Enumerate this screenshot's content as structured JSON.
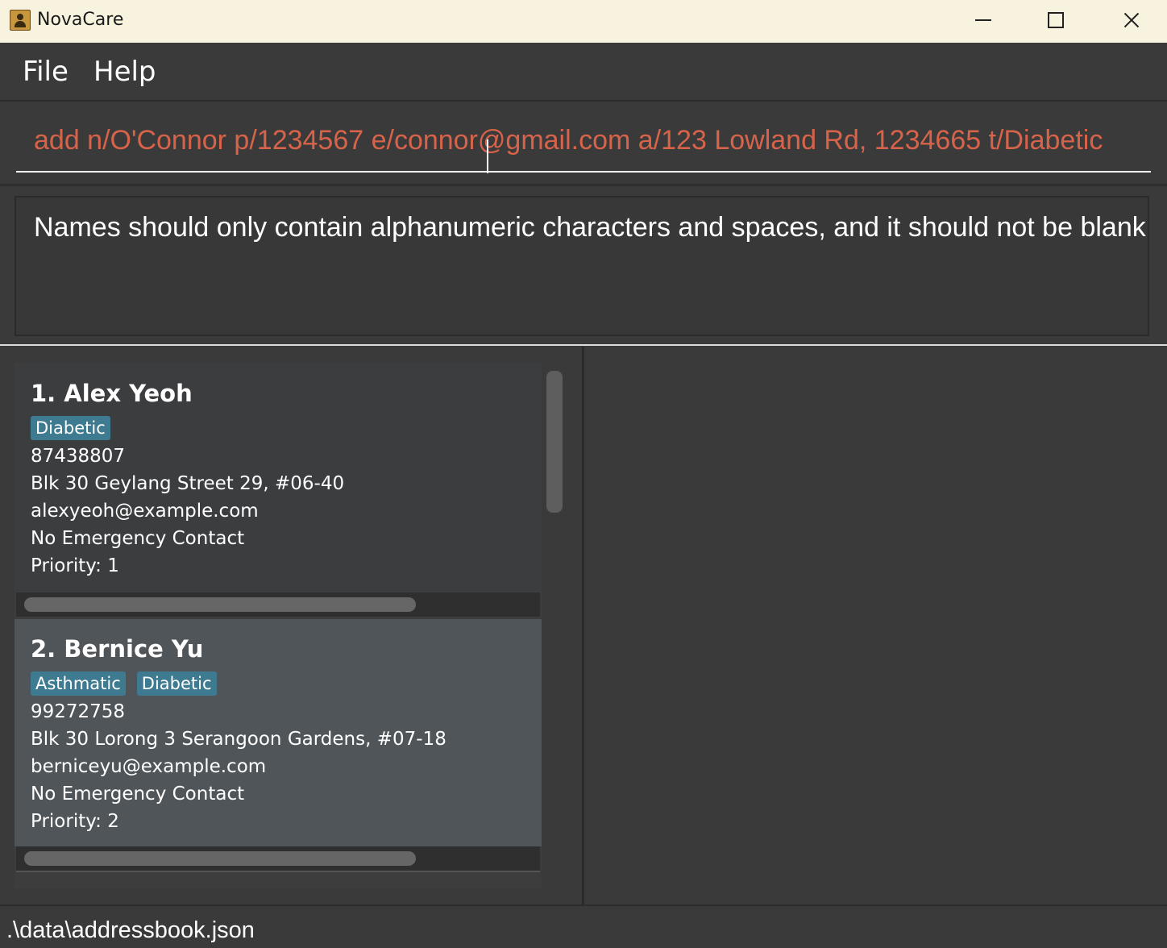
{
  "window": {
    "title": "NovaCare"
  },
  "menu": {
    "file": "File",
    "help": "Help"
  },
  "command": {
    "value": "add n/O'Connor p/1234567 e/connor@gmail.com a/123 Lowland Rd, 1234665 t/Diabetic"
  },
  "result": {
    "message": "Names should only contain alphanumeric characters and spaces, and it should not be blank"
  },
  "persons": [
    {
      "name": "1. Alex Yeoh",
      "tags": [
        "Diabetic"
      ],
      "phone": "87438807",
      "address": "Blk 30 Geylang Street 29, #06-40",
      "email": "alexyeoh@example.com",
      "emergency": "No Emergency Contact",
      "priority": "Priority: 1"
    },
    {
      "name": "2. Bernice Yu",
      "tags": [
        "Asthmatic",
        "Diabetic"
      ],
      "phone": "99272758",
      "address": "Blk 30 Lorong 3 Serangoon Gardens, #07-18",
      "email": "berniceyu@example.com",
      "emergency": "No Emergency Contact",
      "priority": "Priority: 2"
    }
  ],
  "status": {
    "file_path": ".\\data\\addressbook.json"
  },
  "colors": {
    "tag": "#3e7b91",
    "command_text": "#d6634a",
    "selected_card": "#4f5559"
  },
  "icons": {
    "app": "person-book-icon",
    "minimize": "minimize-icon",
    "maximize": "maximize-icon",
    "close": "close-icon"
  }
}
